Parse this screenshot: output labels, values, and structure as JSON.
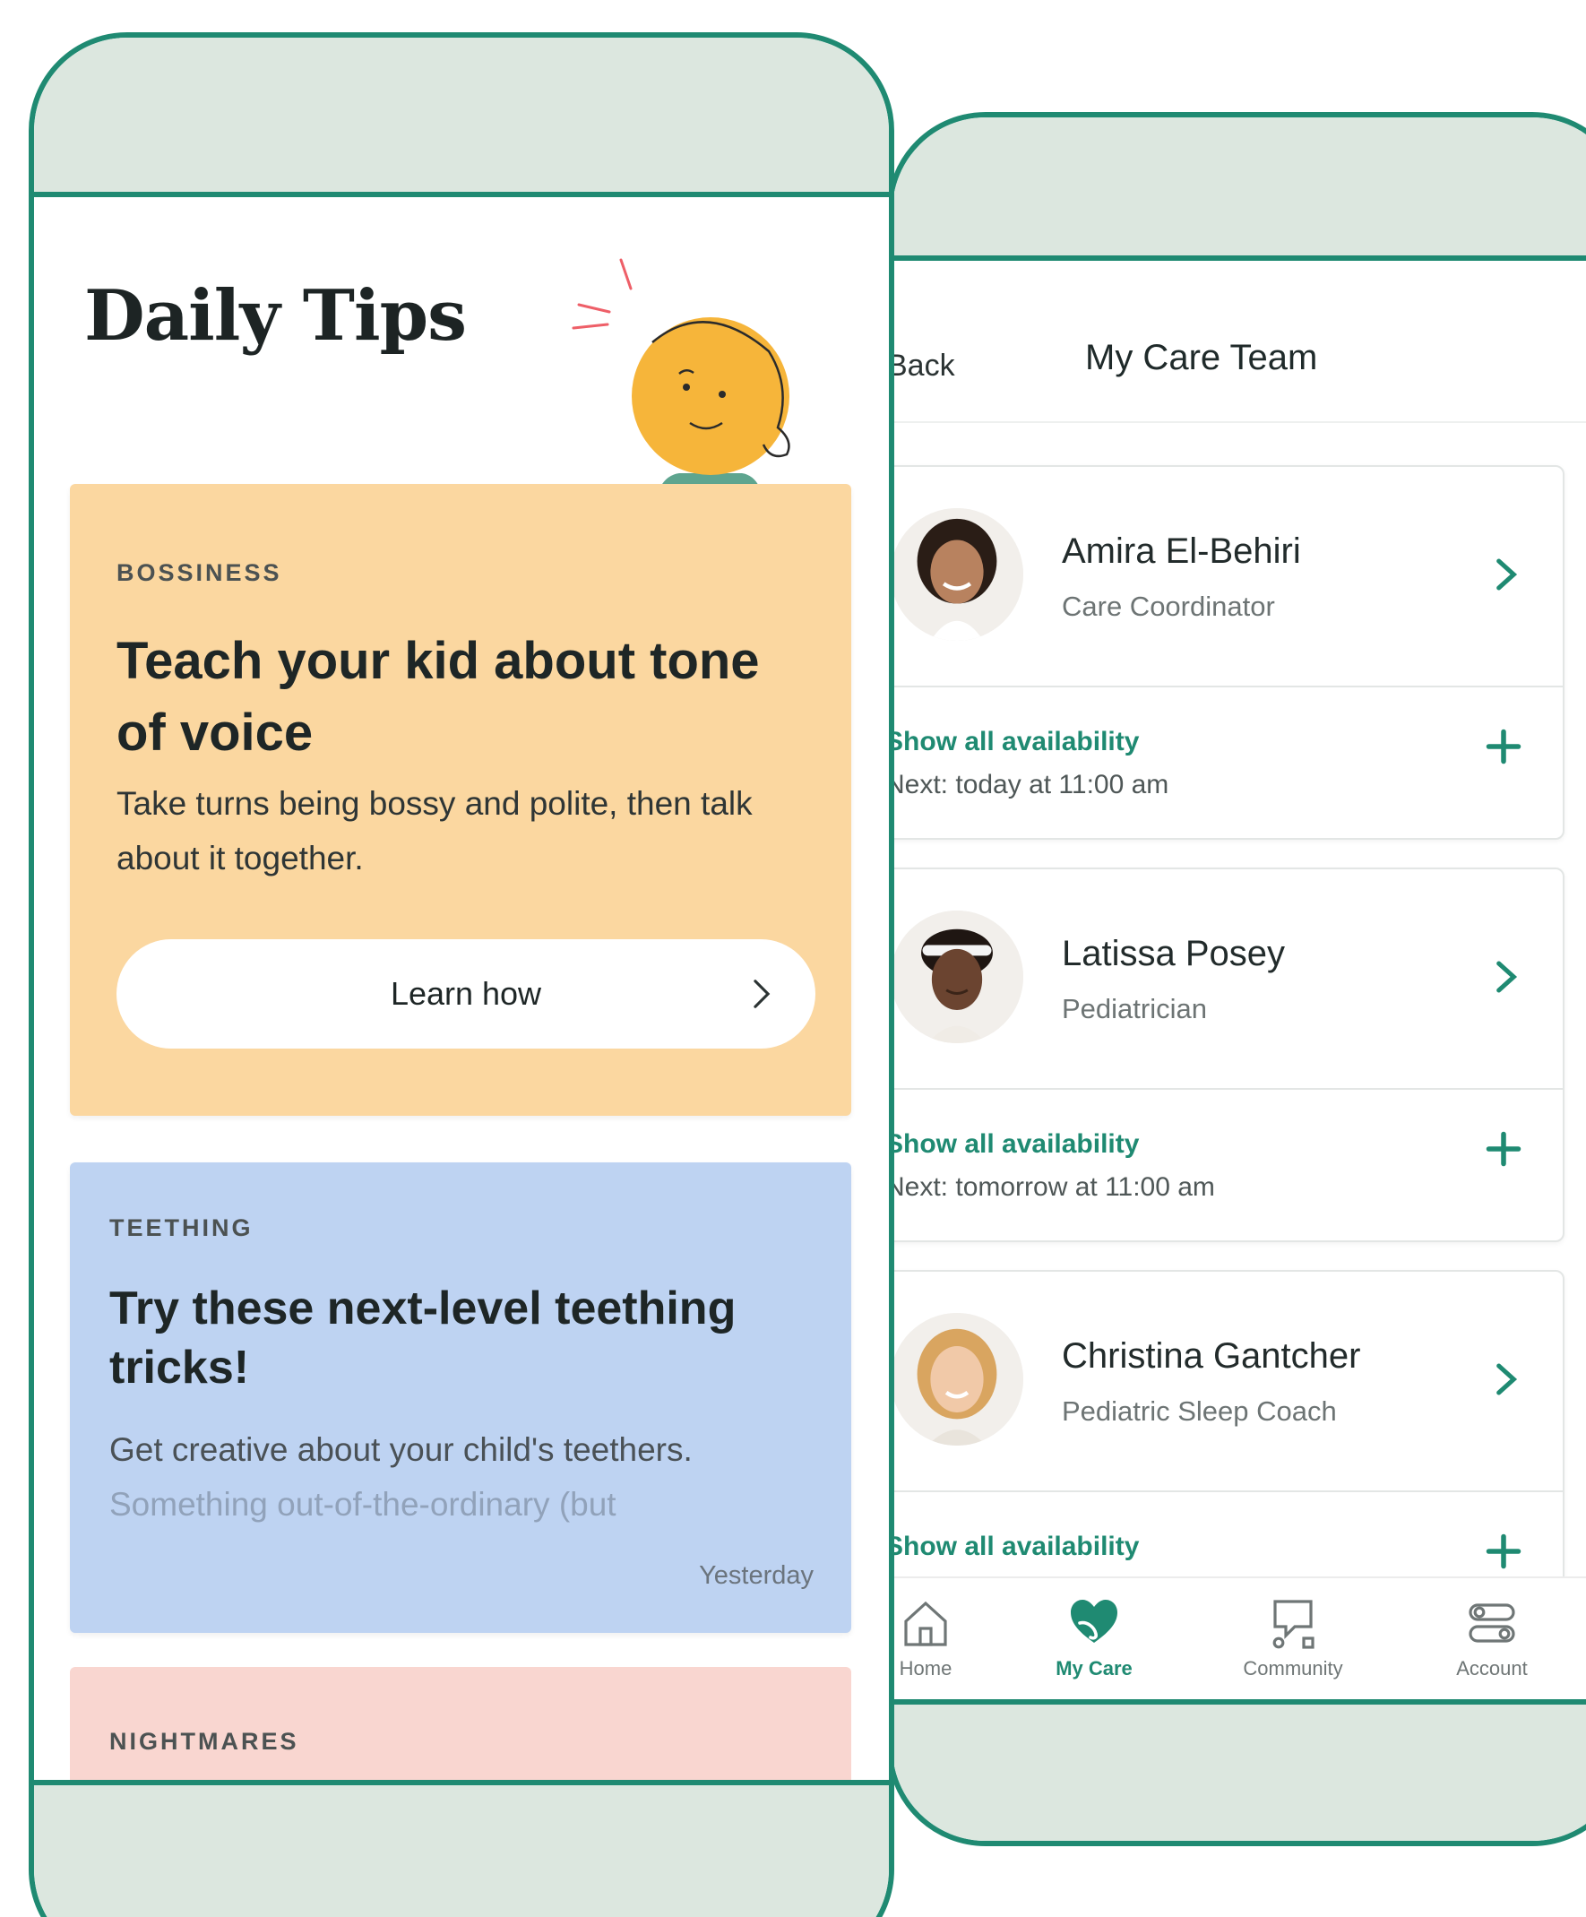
{
  "colors": {
    "brand_green": "#1f8a72",
    "bezel": "#dce7df",
    "card_orange": "#fbd7a0",
    "card_blue": "#bed3f2",
    "card_pink": "#f9d6d0"
  },
  "daily_tips": {
    "title": "Daily Tips",
    "illustration": "kid-face-illustration",
    "cards": [
      {
        "category": "BOSSINESS",
        "title": "Teach your kid about tone of voice",
        "body": "Take turns being bossy and polite, then talk about it together.",
        "button_label": "Learn how"
      },
      {
        "category": "TEETHING",
        "title": "Try these next-level teething tricks!",
        "body": "Get creative about your child's teethers.",
        "body_faded": "Something out-of-the-ordinary (but",
        "date": "Yesterday"
      },
      {
        "category": "NIGHTMARES"
      }
    ]
  },
  "care_team": {
    "back_label": "Back",
    "title": "My Care Team",
    "members": [
      {
        "name": "Amira El-Behiri",
        "role": "Care Coordinator",
        "availability_link": "Show all availability",
        "next": "Next: today at 11:00 am"
      },
      {
        "name": "Latissa Posey",
        "role": "Pediatrician",
        "availability_link": "Show all availability",
        "next": "Next: tomorrow at 11:00 am"
      },
      {
        "name": "Christina Gantcher",
        "role": "Pediatric Sleep Coach",
        "availability_link": "Show all availability",
        "next": ""
      }
    ],
    "tabs": [
      {
        "label": "Home",
        "icon": "home-icon"
      },
      {
        "label": "My Care",
        "icon": "heart-hand-icon"
      },
      {
        "label": "Community",
        "icon": "chat-icon"
      },
      {
        "label": "Account",
        "icon": "toggles-icon"
      }
    ],
    "active_tab": "My Care"
  }
}
